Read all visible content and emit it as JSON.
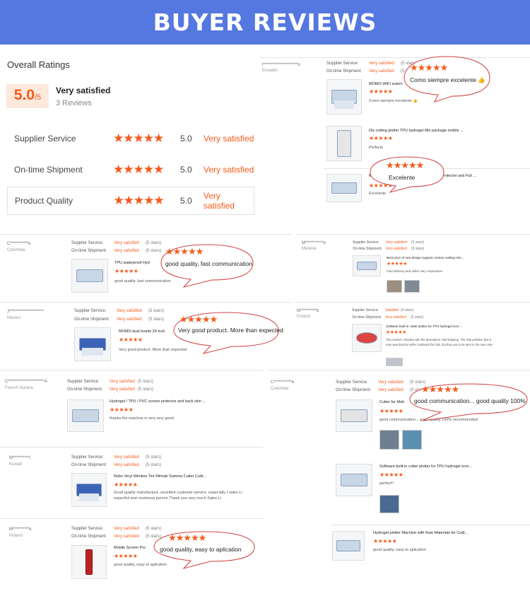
{
  "banner": {
    "title": "BUYER REVIEWS"
  },
  "overall": {
    "title": "Overall Ratings",
    "score": "5.0",
    "out_of": "/5",
    "label": "Very satisfied",
    "count": "3 Reviews",
    "rows": [
      {
        "label": "Supplier Service",
        "stars": "★★★★★",
        "value": "5.0",
        "status": "Very satisfied"
      },
      {
        "label": "On-time Shipment",
        "stars": "★★★★★",
        "value": "5.0",
        "status": "Very satisfied"
      },
      {
        "label": "Product Quality",
        "stars": "★★★★★",
        "value": "5.0",
        "status": "Very satisfied"
      }
    ]
  },
  "meta_labels": {
    "supplier": "Supplier Service:",
    "shipment": "On-time Shipment:"
  },
  "reviews": {
    "ecuador": {
      "user": "l*********************o",
      "country": "Ecuador",
      "supplier": "Very satisfied",
      "supplier_s": "(5 stars)",
      "shipment": "Very satisfied",
      "shipment_s": "(5 stars)",
      "products": [
        {
          "title": "MOMO WIFI autom",
          "stars": "★★★★★",
          "comment": "Como siempre excelente 👍"
        },
        {
          "title": "Diy cutting plotter TPU hydrogel film package mobile ...",
          "stars": "★★★★★",
          "comment": "Perfecto"
        },
        {
          "title": "Ma",
          "title2": "rotector and Full ...",
          "stars": "★★★★★",
          "comment": "Excelente"
        }
      ],
      "bubble1": {
        "stars": "★★★★★",
        "text": "Como siempre excelente 👍"
      },
      "bubble2": {
        "stars": "★★★★★",
        "text": "Excelente"
      }
    },
    "colombia1": {
      "user": "C***********e",
      "country": "Colombia",
      "supplier": "Very satisfied",
      "supplier_s": "(5 stars)",
      "shipment": "Very satisfied",
      "shipment_s": "(5 stars)",
      "title": "TPU waterproof Hyd",
      "stars": "★★★★★",
      "comment": "good quality, fast communication",
      "bubble": {
        "stars": "★★★★★",
        "text": "good quality, fast communication"
      }
    },
    "melanie": {
      "user": "M***********e",
      "country": "Melanie",
      "supplier": "Very satisfied",
      "supplier_s": "(5 stars)",
      "shipment": "Very satisfied",
      "shipment_s": "(5 stars)",
      "title": "Best price of new design support contour cutting mini...",
      "stars": "★★★★★",
      "comment": "Fast delivery and seller very responsive"
    },
    "mexico": {
      "user": "J*********************",
      "country": "Mexico",
      "supplier": "Very satisfied",
      "supplier_s": "(5 stars)",
      "shipment": "Very satisfied",
      "shipment_s": "(5 stars)",
      "title": "MOMO dual heads 24 inch",
      "stars": "★★★★★",
      "comment": "Very good product. More than expected",
      "bubble": {
        "stars": "★★★★★",
        "text": "Very good product. More than expected"
      }
    },
    "poland1": {
      "user": "M**********k",
      "country": "Poland",
      "supplier": "Satisfied",
      "supplier_s": "(4 stars)",
      "shipment": "Very satisfied",
      "shipment_s": "(5 stars)",
      "title": "Software built-in cutter plotter for TPU hydrogel scre...",
      "stars": "★★★★★",
      "comment": "The product complies with the description. fast shipping. The only problem that a",
      "comment2": "note was that the seller confused the foils, but they are to be sent in the next orde"
    },
    "guiana": {
      "user": "C**********************A",
      "country": "French Guiana",
      "supplier": "Very satisfied",
      "supplier_s": "(5 stars)",
      "shipment": "Very satisfied",
      "shipment_s": "(5 stars)",
      "title": "Hydrogel / TPU / PVC screen protector and back skin ...",
      "stars": "★★★★★",
      "comment": "thanks the machine is very very good"
    },
    "colombia2": {
      "user": "C***********e",
      "country": "Colombia",
      "supplier": "Very satisfied",
      "supplier_s": "(5 stars)",
      "shipment": "Very satisfied",
      "shipment_s": "(5 stars)",
      "products": [
        {
          "title": "Cutter for Mob",
          "stars": "★★★★★",
          "comment": "good communication... good quality 100% recommended"
        },
        {
          "title": "Software built-in cutter plotter for TPU hydrogel scre...",
          "stars": "★★★★★",
          "comment": "perfect!!"
        },
        {
          "title": "Hydrogel plotter Machine with Raw Materials for Cutti...",
          "stars": "★★★★★",
          "comment": "good quality, easy to aplication"
        }
      ],
      "bubble": {
        "stars": "★★★★★",
        "text": "good communication... good quality 100%"
      }
    },
    "kuwait": {
      "user": "M**********l",
      "country": "Kuwait",
      "supplier": "Very satisfied",
      "supplier_s": "(5 stars)",
      "shipment": "Very satisfied",
      "shipment_s": "(5 stars)",
      "title": "Robs Vinyl Window Tint Mimaki Summa Cutter Cutti...",
      "stars": "★★★★★",
      "comment": "Good quality manufacture, excellent customer service, especially ( sales Li",
      "comment2": "espectful and courteous person Thank you very much Sales Li"
    },
    "poland2": {
      "user": "M**********k",
      "country": "Poland",
      "supplier": "Very satisfied",
      "supplier_s": "(5 stars)",
      "shipment": "Very satisfied",
      "shipment_s": "(5 stars)",
      "title": "Mobile Screen Pro",
      "stars": "★★★★★",
      "comment": "good quality, easy to aplication",
      "bubble": {
        "stars": "★★★★★",
        "text": "good quality, easy to aplication"
      }
    }
  }
}
